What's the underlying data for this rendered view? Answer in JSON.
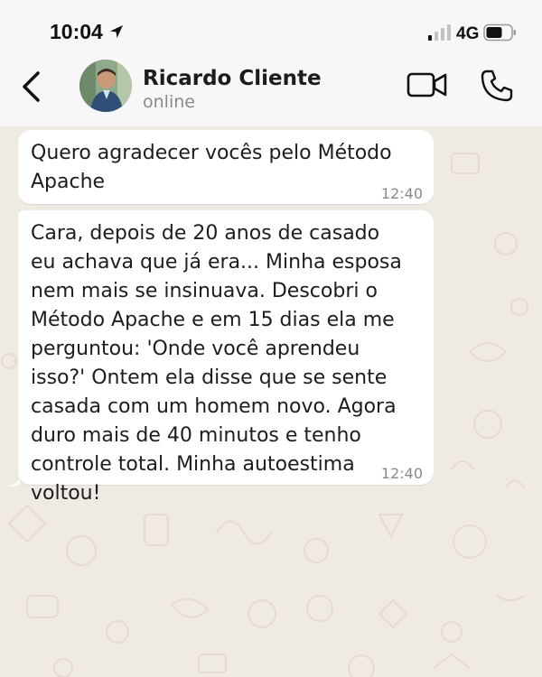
{
  "status_bar": {
    "time": "10:04",
    "network": "4G",
    "icons": [
      "location-arrow-icon",
      "signal-bars-icon",
      "battery-icon"
    ]
  },
  "header": {
    "contact_name": "Ricardo Cliente",
    "contact_status": "online",
    "icons": [
      "back-arrow-icon",
      "video-call-icon",
      "phone-call-icon"
    ]
  },
  "messages": [
    {
      "text": "Quero agradecer vocês pelo Método Apache",
      "time": "12:40"
    },
    {
      "text": "Cara, depois de 20 anos de casado eu achava que já era... Minha esposa nem mais se insinuava. Descobri o Método Apache e em 15 dias ela me perguntou: 'Onde você aprendeu isso?' Ontem ela disse que se sente casada com um homem novo. Agora duro mais de 40 minutos e tenho controle total. Minha autoestima voltou!",
      "time": "12:40"
    }
  ],
  "colors": {
    "header_bg": "#f7f7f7",
    "chat_bg": "#efeae2",
    "bubble_bg": "#ffffff",
    "muted_text": "#8a8a8a"
  }
}
